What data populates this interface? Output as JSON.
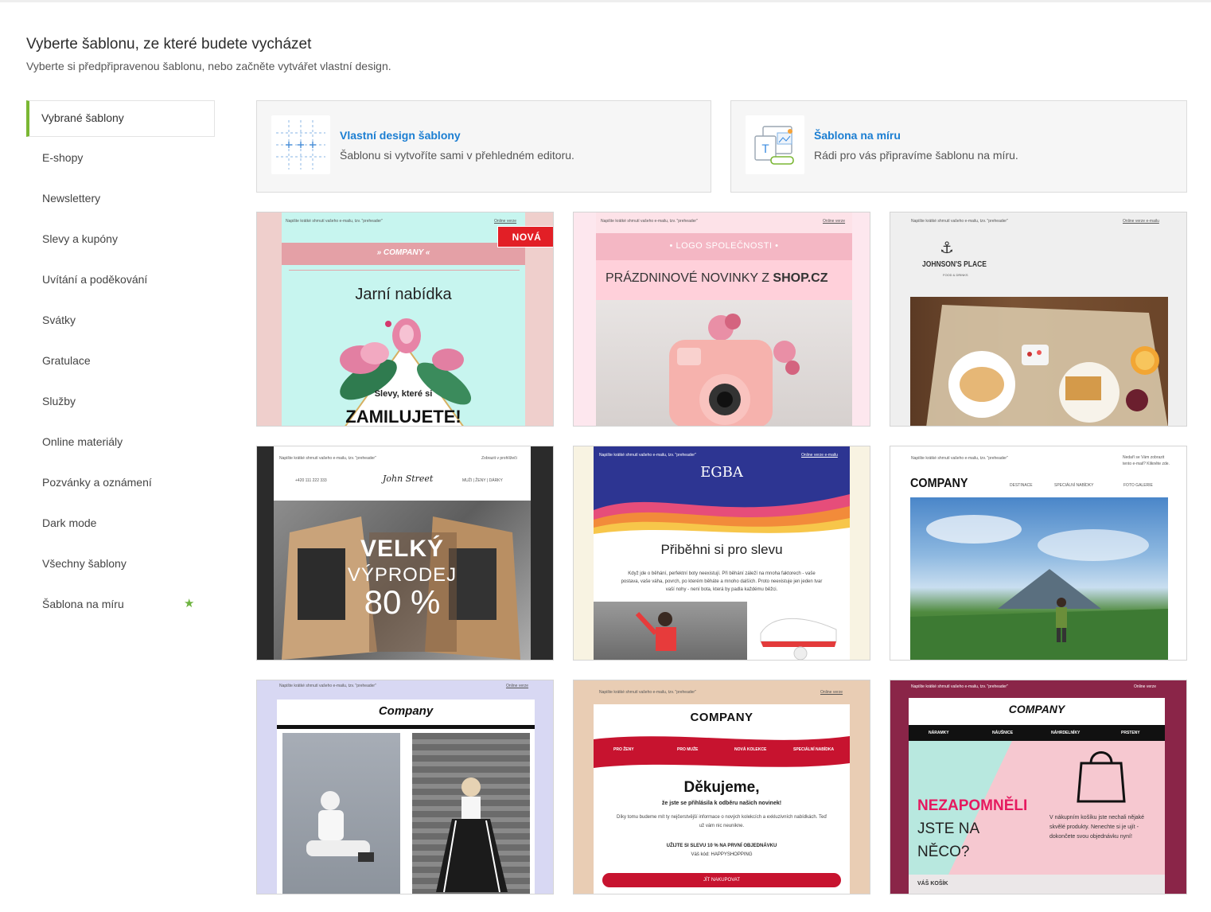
{
  "header": {
    "title": "Vyberte šablonu, ze které budete vycházet",
    "subtitle": "Vyberte si předpřipravenou šablonu, nebo začněte vytvářet vlastní design."
  },
  "sidebar": {
    "items": [
      {
        "label": "Vybrané šablony"
      },
      {
        "label": "E-shopy"
      },
      {
        "label": "Newslettery"
      },
      {
        "label": "Slevy a kupóny"
      },
      {
        "label": "Uvítání a poděkování"
      },
      {
        "label": "Svátky"
      },
      {
        "label": "Gratulace"
      },
      {
        "label": "Služby"
      },
      {
        "label": "Online materiály"
      },
      {
        "label": "Pozvánky a oznámení"
      },
      {
        "label": "Dark mode"
      },
      {
        "label": "Všechny šablony"
      },
      {
        "label": "Šablona na míru"
      }
    ],
    "star": "★"
  },
  "cards": {
    "custom": {
      "title": "Vlastní design šablony",
      "desc": "Šablonu si vytvoříte sami v přehledném editoru."
    },
    "tailored": {
      "title": "Šablona na míru",
      "desc": "Rádi pro vás připravíme šablonu na míru."
    }
  },
  "colors": {
    "accent": "#7ab733",
    "link": "#1b7ed2",
    "badge": "#e21f26"
  },
  "templates": {
    "preheader": "Napište krátké shrnutí vašeho e-mailu, tzv. \"preheader\"",
    "online": "Online verze",
    "online_email": "Online verze e-mailu",
    "t1": {
      "badge": "NOVÁ",
      "logo": "» COMPANY «",
      "heading": "Jarní nabídka",
      "line": "Slevy, které si",
      "big": "ZAMILUJETE!"
    },
    "t2": {
      "logo": "• LOGO SPOLEČNOSTI •",
      "heading_a": "PRÁZDNINOVÉ NOVINKY Z ",
      "heading_b": "SHOP.CZ"
    },
    "t3": {
      "logo": "JOHNSON'S PLACE",
      "logo_sub": "FOOD & DRINKS"
    },
    "t4": {
      "show": "Zobrazit v prohlížeči",
      "phone": "+420 111 222 333",
      "brand": "John Street",
      "nav": "MUŽI | ŽENY | DÁRKY",
      "big1": "VELKÝ",
      "big2": "VÝPRODEJ",
      "big3": "80 %"
    },
    "t5": {
      "logo": "EGBA",
      "heading": "Přiběhni si pro slevu",
      "body": "Když jde o běhání, perfektní boty neexistují. Při běhání záleží na mnoha faktorech - vaše postava, vaše váha, povrch, po kterém běháte a mnoho dalších. Proto neexistuje jen jeden tvar vaší nohy - není bota, která by padla každému běžci."
    },
    "t6": {
      "note": "Nedaří se Vám zobrazit tento e-mail? Klikněte zde.",
      "logo": "COMPANY",
      "nav": [
        "DESTINACE",
        "SPECIÁLNÍ NABÍDKY",
        "FOTO GALERIE"
      ]
    },
    "t7": {
      "logo": "Company"
    },
    "t8": {
      "logo": "COMPANY",
      "nav": [
        "PRO ŽENY",
        "PRO MUŽE",
        "NOVÁ KOLEKCE",
        "SPECIÁLNÍ NABÍDKA"
      ],
      "heading": "Děkujeme,",
      "sub": "že jste se přihlásila k odběru našich novinek!",
      "body": "Díky tomu budeme mít ty nejčerstvější informace o nových kolekcích a exkluzivních nabídkách. Teď už vám nic neunikne.",
      "promo": "UŽIJTE SI SLEVU 10 % NA PRVNÍ OBJEDNÁVKU",
      "code": "Váš kód: HAPPYSHOPPING",
      "cta": "JÍT NAKUPOVAT"
    },
    "t9": {
      "logo": "COMPANY",
      "nav": [
        "NÁRAMKY",
        "NÁUŠNICE",
        "NÁHRDELNÍKY",
        "PRSTENY"
      ],
      "h1": "NEZAPOMNĚLI",
      "h2": "JSTE NA",
      "h3": "NĚCO?",
      "body": "V nákupním košíku jste nechali nějaké skvělé produkty. Nenechte si je ujít - dokončete svou objednávku nyní!",
      "cart": "VÁŠ KOŠÍK"
    }
  }
}
